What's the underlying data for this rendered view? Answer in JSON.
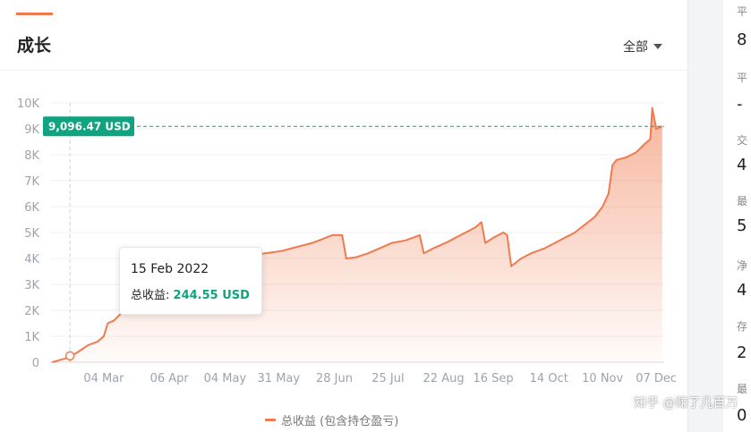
{
  "header": {
    "title": "成长",
    "range_label": "全部"
  },
  "tooltip": {
    "date": "15 Feb 2022",
    "label": "总收益:",
    "value": "244.55 USD"
  },
  "current_marker": {
    "value_label": "9,096.47 USD"
  },
  "legend": {
    "label": "总收益 (包含持仓盈亏)"
  },
  "colors": {
    "accent": "#f07a4d",
    "marker": "#10a37f"
  },
  "sidebar": {
    "labels": [
      "平",
      "平",
      "交",
      "最",
      "净",
      "存",
      "最"
    ],
    "values": [
      "8",
      "-",
      "4",
      "5",
      "4",
      "2",
      "0"
    ]
  },
  "watermark": "知乎 @赚了几百万",
  "chart_data": {
    "type": "area",
    "series": [
      {
        "x": [
          "2022-02-06",
          "2022-02-13",
          "2022-02-15",
          "2022-02-18",
          "2022-02-21",
          "2022-02-24",
          "2022-03-01",
          "2022-03-04",
          "2022-03-06",
          "2022-03-09",
          "2022-03-13",
          "2022-03-18",
          "2022-03-23",
          "2022-03-28",
          "2022-04-02",
          "2022-04-06",
          "2022-04-11",
          "2022-04-16",
          "2022-04-22",
          "2022-04-28",
          "2022-05-04",
          "2022-05-09",
          "2022-05-14",
          "2022-05-19",
          "2022-05-24",
          "2022-05-29",
          "2022-06-02",
          "2022-06-07",
          "2022-06-12",
          "2022-06-17",
          "2022-06-22",
          "2022-06-27",
          "2022-07-02",
          "2022-07-04",
          "2022-07-09",
          "2022-07-15",
          "2022-07-21",
          "2022-07-27",
          "2022-08-03",
          "2022-08-10",
          "2022-08-12",
          "2022-08-17",
          "2022-08-23",
          "2022-08-28",
          "2022-09-02",
          "2022-09-07",
          "2022-09-10",
          "2022-09-12",
          "2022-09-16",
          "2022-09-21",
          "2022-09-23",
          "2022-09-25",
          "2022-09-30",
          "2022-10-05",
          "2022-10-12",
          "2022-10-17",
          "2022-10-22",
          "2022-10-27",
          "2022-11-01",
          "2022-11-06",
          "2022-11-10",
          "2022-11-13",
          "2022-11-15",
          "2022-11-17",
          "2022-11-22",
          "2022-11-27",
          "2022-12-01",
          "2022-12-04",
          "2022-12-05",
          "2022-12-07",
          "2022-12-10"
        ],
        "y": [
          0,
          150,
          244.55,
          350,
          500,
          650,
          800,
          1000,
          1500,
          1600,
          1900,
          2200,
          2600,
          3000,
          3200,
          3400,
          3600,
          3700,
          3800,
          3900,
          3900,
          4000,
          4050,
          4100,
          4200,
          4250,
          4300,
          4400,
          4500,
          4600,
          4750,
          4900,
          4900,
          4000,
          4050,
          4200,
          4400,
          4600,
          4700,
          4900,
          4200,
          4400,
          4600,
          4800,
          5000,
          5200,
          5400,
          4600,
          4800,
          5000,
          4900,
          3700,
          4000,
          4200,
          4400,
          4600,
          4800,
          5000,
          5300,
          5600,
          6000,
          6500,
          7600,
          7800,
          7900,
          8100,
          8400,
          8600,
          9800,
          9000,
          9096.47
        ]
      }
    ],
    "xticks": [
      "04 Mar",
      "06 Apr",
      "04 May",
      "31 May",
      "28 Jun",
      "25 Jul",
      "22 Aug",
      "16 Sep",
      "14 Oct",
      "10 Nov",
      "07 Dec"
    ],
    "xtick_dates": [
      "2022-03-04",
      "2022-04-06",
      "2022-05-04",
      "2022-05-31",
      "2022-06-28",
      "2022-07-25",
      "2022-08-22",
      "2022-09-16",
      "2022-10-14",
      "2022-11-10",
      "2022-12-07"
    ],
    "yticks": [
      0,
      1000,
      2000,
      3000,
      4000,
      5000,
      6000,
      7000,
      8000,
      9000,
      10000
    ],
    "ytick_labels": [
      "0",
      "1K",
      "2K",
      "3K",
      "4K",
      "5K",
      "6K",
      "7K",
      "8K",
      "9K",
      "10K"
    ],
    "ylim": [
      0,
      10000
    ],
    "xlim": [
      "2022-02-05",
      "2022-12-11"
    ],
    "grid": true,
    "legend_position": "bottom-center",
    "highlighted_point": {
      "x": "2022-02-15",
      "y": 244.55
    },
    "reference_line_y": 9096.47
  }
}
